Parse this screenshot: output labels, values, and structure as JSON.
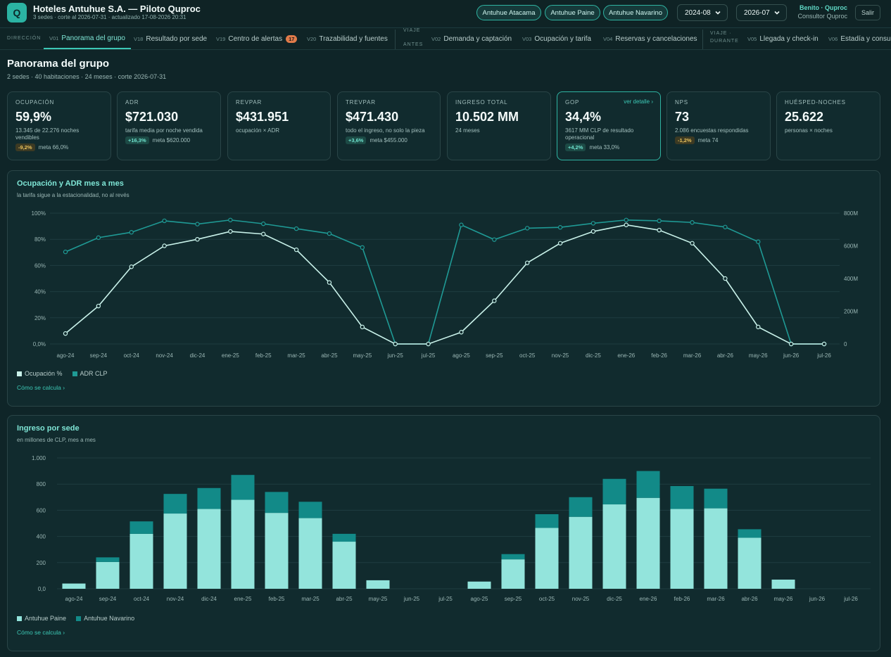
{
  "header": {
    "logo_letter": "Q",
    "title": "Hoteles Antuhue S.A. — Piloto Quproc",
    "subtitle": "3 sedes · corte al 2026-07-31 · actualizado 17-08-2026 20:31",
    "sedes": [
      "Antuhue Atacama",
      "Antuhue Paine",
      "Antuhue Navarino"
    ],
    "period_from": "2024-08",
    "period_to": "2026-07",
    "user_name": "Benito · Quproc",
    "user_role": "Consultor Quproc",
    "logout_label": "Salir"
  },
  "nav": {
    "group_direccion": "DIRECCIÓN",
    "group_antes": [
      "VIAJE",
      "ANTES"
    ],
    "group_durante": [
      "VIAJE ·",
      "DURANTE"
    ],
    "tabs": [
      {
        "code": "V01",
        "label": "Panorama del grupo"
      },
      {
        "code": "V18",
        "label": "Resultado por sede"
      },
      {
        "code": "V19",
        "label": "Centro de alertas",
        "count": "17"
      },
      {
        "code": "V20",
        "label": "Trazabilidad y fuentes"
      },
      {
        "code": "V02",
        "label": "Demanda y captación"
      },
      {
        "code": "V03",
        "label": "Ocupación y tarifa"
      },
      {
        "code": "V04",
        "label": "Reservas y cancelaciones"
      },
      {
        "code": "V05",
        "label": "Llegada y check-in"
      },
      {
        "code": "V06",
        "label": "Estadía y consumo"
      }
    ]
  },
  "page": {
    "title": "Panorama del grupo",
    "subtitle": "2 sedes · 40 habitaciones · 24 meses · corte 2026-07-31"
  },
  "kpis": [
    {
      "label": "OCUPACIÓN",
      "value": "59,9%",
      "desc": "13.345 de 22.276 noches vendibles",
      "delta": "-9,2%",
      "delta_type": "neg",
      "meta": "meta 66,0%"
    },
    {
      "label": "ADR",
      "value": "$721.030",
      "desc": "tarifa media por noche vendida",
      "delta": "+16,3%",
      "delta_type": "pos",
      "meta": "meta $620.000"
    },
    {
      "label": "REVPAR",
      "value": "$431.951",
      "desc": "ocupación × ADR"
    },
    {
      "label": "TREVPAR",
      "value": "$471.430",
      "desc": "todo el ingreso, no solo la pieza",
      "delta": "+3,6%",
      "delta_type": "pos",
      "meta": "meta $455.000"
    },
    {
      "label": "INGRESO TOTAL",
      "value": "10.502 MM",
      "desc": "24 meses"
    },
    {
      "label": "GOP",
      "value": "34,4%",
      "desc": "3617 MM CLP de resultado operacional",
      "delta": "+4,2%",
      "delta_type": "pos",
      "meta": "meta 33,0%",
      "link": "ver detalle ›"
    },
    {
      "label": "NPS",
      "value": "73",
      "desc": "2.086 encuestas respondidas",
      "delta": "-1,2%",
      "delta_type": "neg",
      "meta": "meta 74"
    },
    {
      "label": "HUÉSPED-NOCHES",
      "value": "25.622",
      "desc": "personas × noches"
    }
  ],
  "panel1": {
    "title": "Ocupación y ADR mes a mes",
    "subtitle": "la tarifa sigue a la estacionalidad, no al revés",
    "how": "Cómo se calcula ›"
  },
  "panel2": {
    "title": "Ingreso por sede",
    "subtitle": "en millones de CLP, mes a mes",
    "how": "Cómo se calcula ›"
  },
  "colors": {
    "occupancy": "#c9f2ea",
    "adr": "#1f9a95",
    "paine": "#93e4dc",
    "navarino": "#128a88"
  },
  "chart_data": [
    {
      "type": "line",
      "categories": [
        "ago-24",
        "sep-24",
        "oct-24",
        "nov-24",
        "dic-24",
        "ene-25",
        "feb-25",
        "mar-25",
        "abr-25",
        "may-25",
        "jun-25",
        "jul-25",
        "ago-25",
        "sep-25",
        "oct-25",
        "nov-25",
        "dic-25",
        "ene-26",
        "feb-26",
        "mar-26",
        "abr-26",
        "may-26",
        "jun-26",
        "jul-26"
      ],
      "y_left": {
        "ticks": [
          "0,0%",
          "20%",
          "40%",
          "60%",
          "80%",
          "100%"
        ],
        "range": [
          0,
          100
        ]
      },
      "y_right": {
        "ticks": [
          "0",
          "200M",
          "400M",
          "600M",
          "800M"
        ],
        "range": [
          0,
          800
        ]
      },
      "series": [
        {
          "name": "Ocupación %",
          "axis": "left",
          "values": [
            8,
            29,
            59,
            75,
            80,
            86,
            84,
            72,
            47,
            13,
            0,
            0,
            9,
            33,
            62,
            77,
            86,
            91,
            87,
            77,
            50,
            13,
            0,
            0
          ]
        },
        {
          "name": "ADR CLP",
          "axis": "right",
          "values": [
            563,
            650,
            683,
            753,
            733,
            758,
            735,
            705,
            675,
            590,
            0,
            0,
            728,
            638,
            708,
            713,
            738,
            758,
            753,
            743,
            715,
            625,
            0,
            0
          ]
        }
      ]
    },
    {
      "type": "bar",
      "stacked": true,
      "categories": [
        "ago-24",
        "sep-24",
        "oct-24",
        "nov-24",
        "dic-24",
        "ene-25",
        "feb-25",
        "mar-25",
        "abr-25",
        "may-25",
        "jun-25",
        "jul-25",
        "ago-25",
        "sep-25",
        "oct-25",
        "nov-25",
        "dic-25",
        "ene-26",
        "feb-26",
        "mar-26",
        "abr-26",
        "may-26",
        "jun-26",
        "jul-26"
      ],
      "y_ticks": [
        "0,0",
        "200",
        "400",
        "600",
        "800",
        "1.000"
      ],
      "ylim": [
        0,
        1000
      ],
      "series": [
        {
          "name": "Antuhue Paine",
          "values": [
            40,
            205,
            420,
            575,
            610,
            680,
            580,
            540,
            360,
            65,
            0,
            0,
            55,
            225,
            465,
            550,
            645,
            695,
            610,
            615,
            390,
            70,
            0,
            0
          ]
        },
        {
          "name": "Antuhue Navarino",
          "values": [
            0,
            35,
            95,
            150,
            160,
            190,
            160,
            125,
            60,
            0,
            0,
            0,
            0,
            40,
            105,
            150,
            195,
            205,
            175,
            150,
            65,
            0,
            0,
            0
          ]
        }
      ]
    }
  ]
}
